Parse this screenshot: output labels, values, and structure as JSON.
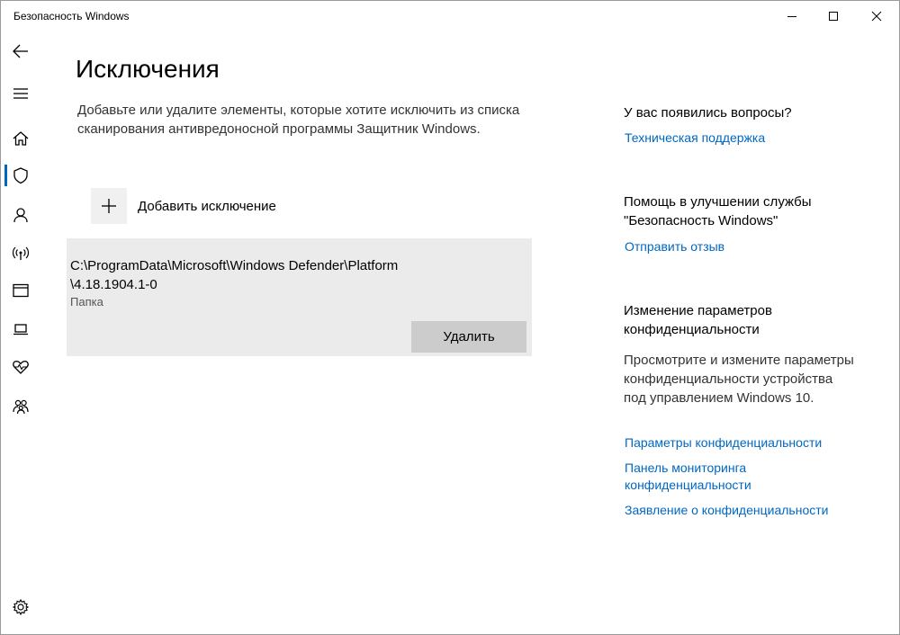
{
  "window": {
    "title": "Безопасность Windows"
  },
  "nav": {
    "items": [
      {
        "name": "back-icon"
      },
      {
        "name": "menu-icon"
      },
      {
        "name": "home-icon"
      },
      {
        "name": "shield-icon",
        "selected": true
      },
      {
        "name": "account-icon"
      },
      {
        "name": "network-icon"
      },
      {
        "name": "app-browser-icon"
      },
      {
        "name": "device-security-icon"
      },
      {
        "name": "device-health-icon"
      },
      {
        "name": "family-icon"
      },
      {
        "name": "settings-icon"
      }
    ],
    "accent_color": "#0067c0"
  },
  "main": {
    "title": "Исключения",
    "description": "Добавьте или удалите элементы, которые хотите исключить из списка сканирования антивредоносной программы Защитник Windows.",
    "add_label": "Добавить исключение",
    "exclusions": [
      {
        "path_line1": "C:\\ProgramData\\Microsoft\\Windows Defender\\Platform",
        "path_line2": "\\4.18.1904.1-0",
        "type": "Папка",
        "remove_label": "Удалить"
      }
    ]
  },
  "side": {
    "questions_heading": "У вас появились вопросы?",
    "support_link": "Техническая поддержка",
    "improve_heading": "Помощь в улучшении службы \"Безопасность Windows\"",
    "feedback_link": "Отправить отзыв",
    "privacy_heading": "Изменение параметров конфиденциальности",
    "privacy_text": "Просмотрите и измените параметры конфиденциальности устройства под управлением Windows 10.",
    "privacy_links": [
      "Параметры конфиденциальности",
      "Панель мониторинга конфиденциальности",
      "Заявление о конфиденциальности"
    ],
    "link_color": "#0067c0"
  }
}
